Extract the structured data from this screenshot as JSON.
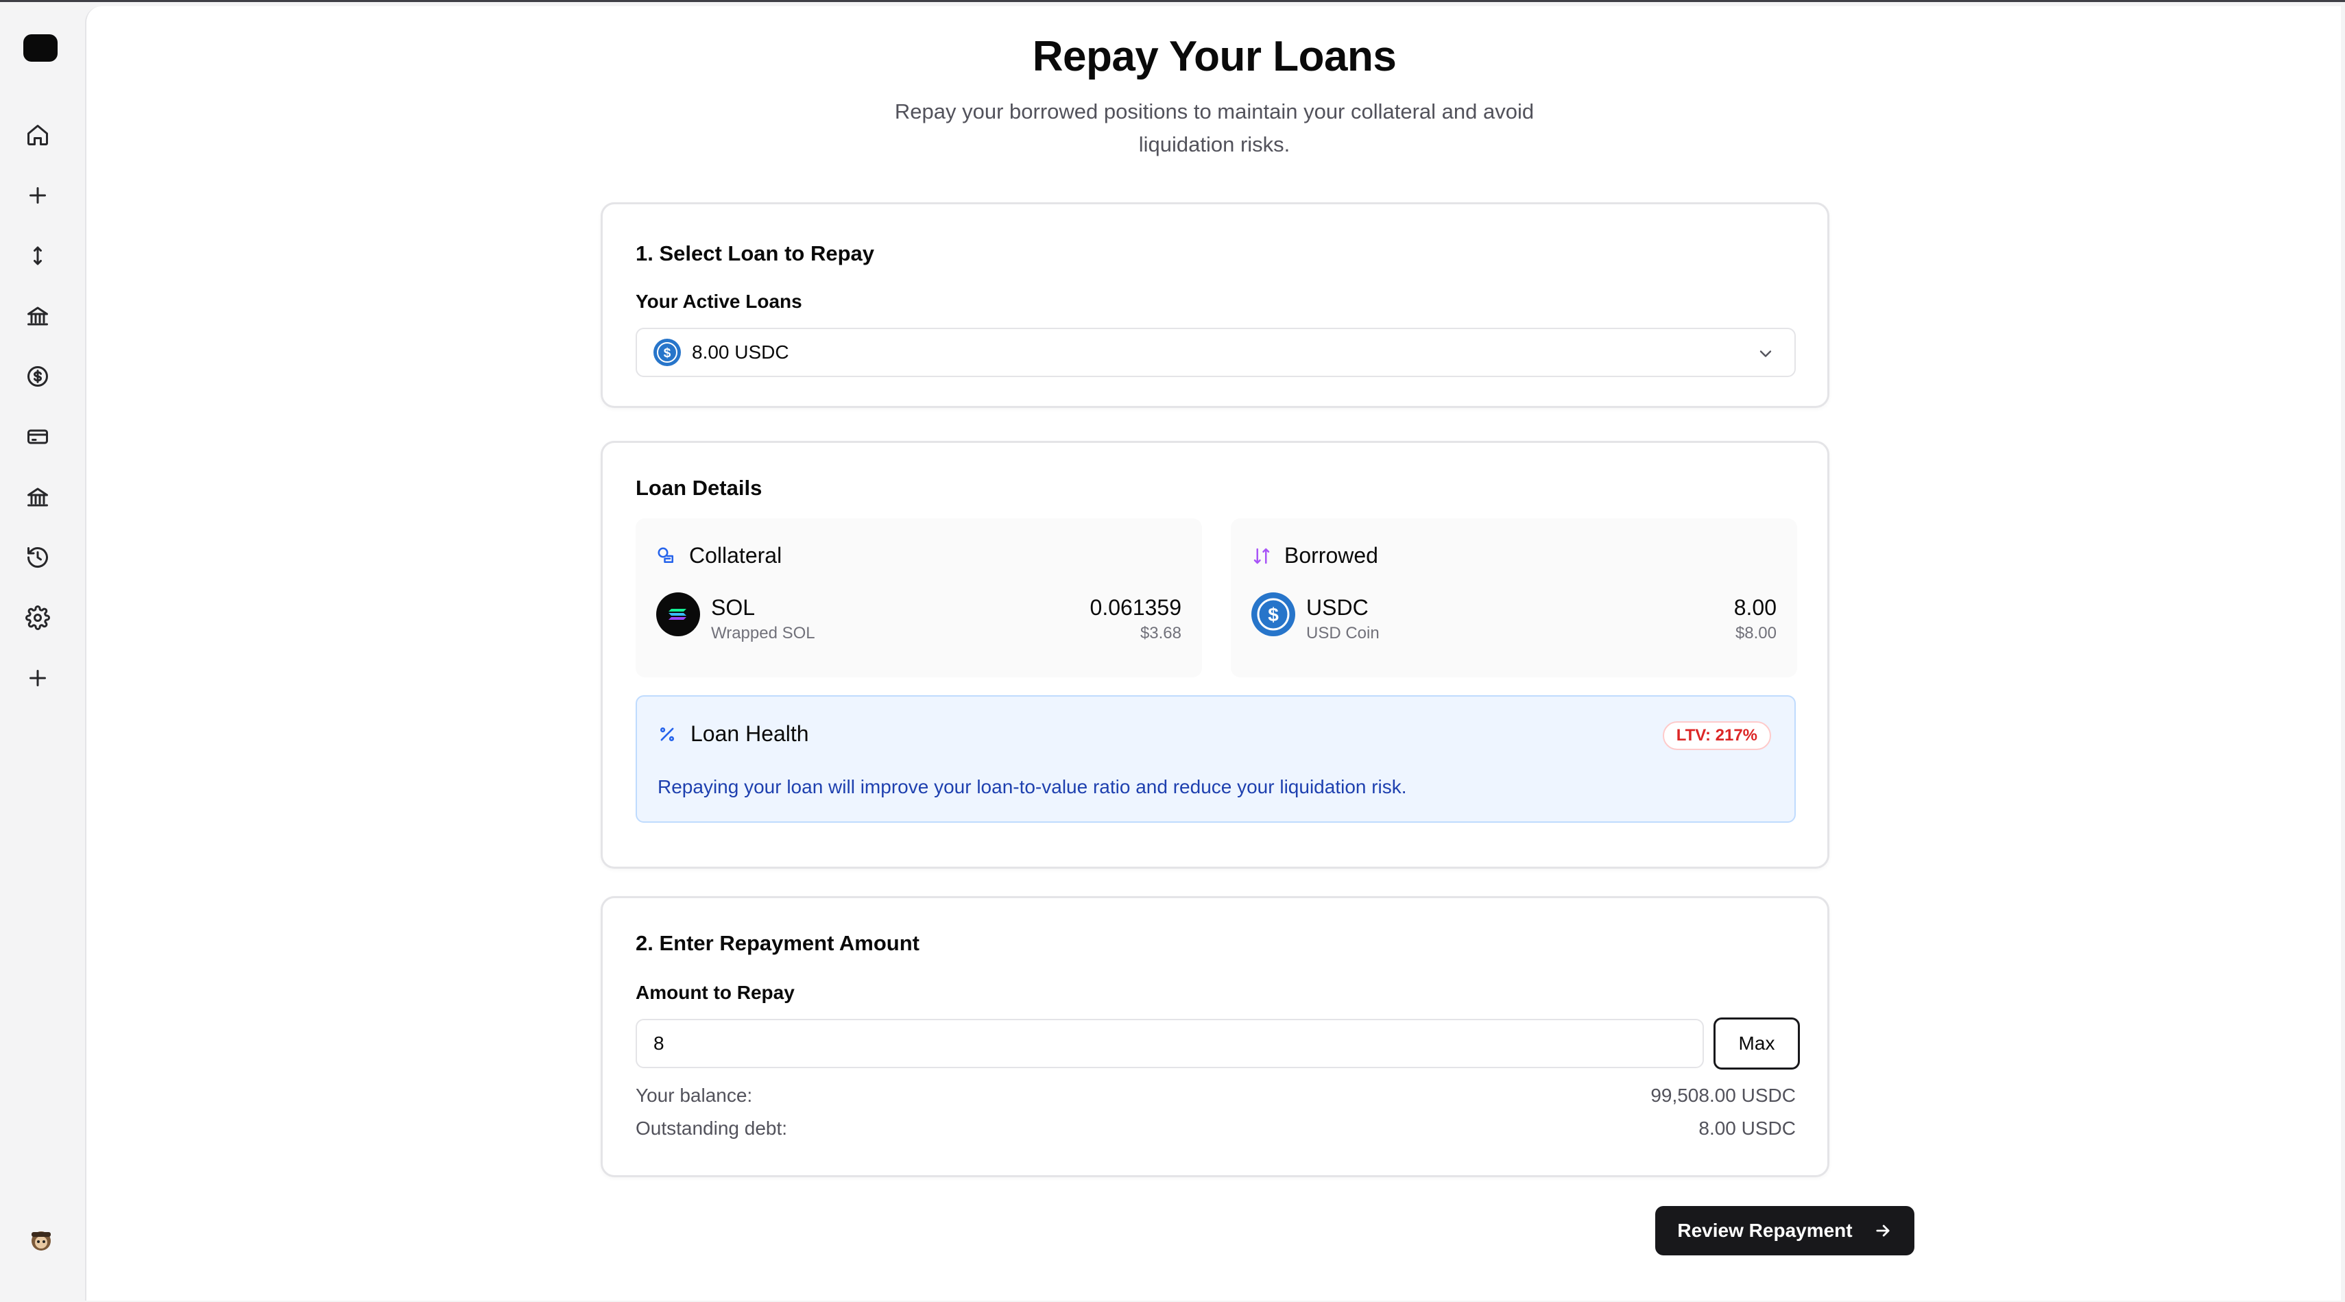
{
  "sidebar": {
    "items": [
      {
        "name": "home-icon"
      },
      {
        "name": "plus-icon"
      },
      {
        "name": "transfer-icon"
      },
      {
        "name": "bank-icon"
      },
      {
        "name": "dollar-icon"
      },
      {
        "name": "credit-card-icon"
      },
      {
        "name": "bank-icon"
      },
      {
        "name": "history-icon"
      },
      {
        "name": "gear-icon"
      },
      {
        "name": "plus-icon"
      }
    ]
  },
  "header": {
    "title": "Repay Your Loans",
    "subtitle": "Repay your borrowed positions to maintain your collateral and avoid liquidation risks."
  },
  "select_section": {
    "title": "1. Select Loan to Repay",
    "label": "Your Active Loans",
    "selected": "8.00 USDC"
  },
  "loan_details": {
    "title": "Loan Details",
    "collateral": {
      "heading": "Collateral",
      "symbol": "SOL",
      "name": "Wrapped SOL",
      "amount": "0.061359",
      "usd": "$3.68"
    },
    "borrowed": {
      "heading": "Borrowed",
      "symbol": "USDC",
      "name": "USD Coin",
      "amount": "8.00",
      "usd": "$8.00"
    },
    "health": {
      "title": "Loan Health",
      "ltv": "LTV: 217%",
      "message": "Repaying your loan will improve your loan-to-value ratio and reduce your liquidation risk."
    }
  },
  "repay_section": {
    "title": "2. Enter Repayment Amount",
    "label": "Amount to Repay",
    "amount_value": "8",
    "max_label": "Max",
    "balance_label": "Your balance:",
    "balance_value": "99,508.00 USDC",
    "debt_label": "Outstanding debt:",
    "debt_value": "8.00 USDC"
  },
  "actions": {
    "review_label": "Review Repayment"
  },
  "colors": {
    "primary": "#18181b",
    "usdc_blue": "#2775ca",
    "health_bg": "#eef5ff",
    "health_text": "#1e40af",
    "ltv_red": "#dc2626",
    "borrowed_purple": "#a855f7"
  }
}
